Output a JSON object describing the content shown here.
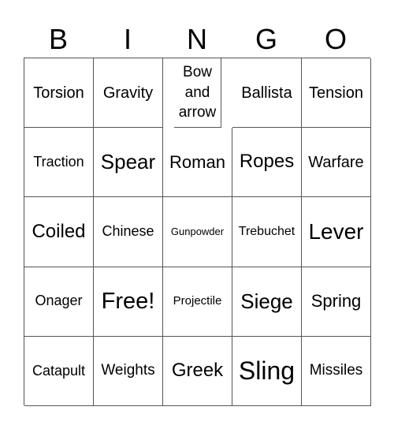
{
  "header": [
    "B",
    "I",
    "N",
    "G",
    "O"
  ],
  "cells": [
    {
      "text": "Torsion",
      "size": 20
    },
    {
      "text": "Gravity",
      "size": 20
    },
    {
      "text": "Bow and arrow",
      "size": 19
    },
    {
      "text": "Ballista",
      "size": 20
    },
    {
      "text": "Tension",
      "size": 20
    },
    {
      "text": "Traction",
      "size": 18
    },
    {
      "text": "Spear",
      "size": 26
    },
    {
      "text": "Roman",
      "size": 22
    },
    {
      "text": "Ropes",
      "size": 24
    },
    {
      "text": "Warfare",
      "size": 20
    },
    {
      "text": "Coiled",
      "size": 24
    },
    {
      "text": "Chinese",
      "size": 18
    },
    {
      "text": "Gunpowder",
      "size": 13
    },
    {
      "text": "Trebuchet",
      "size": 16
    },
    {
      "text": "Lever",
      "size": 28
    },
    {
      "text": "Onager",
      "size": 18
    },
    {
      "text": "Free!",
      "size": 29
    },
    {
      "text": "Projectile",
      "size": 15
    },
    {
      "text": "Siege",
      "size": 26
    },
    {
      "text": "Spring",
      "size": 22
    },
    {
      "text": "Catapult",
      "size": 18
    },
    {
      "text": "Weights",
      "size": 19
    },
    {
      "text": "Greek",
      "size": 24
    },
    {
      "text": "Sling",
      "size": 32
    },
    {
      "text": "Missiles",
      "size": 19
    }
  ]
}
